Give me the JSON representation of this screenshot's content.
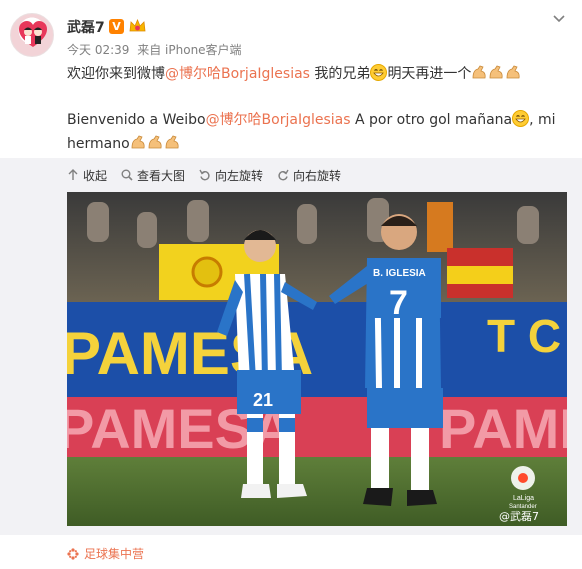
{
  "header": {
    "username": "武磊7",
    "time": "今天 02:39",
    "source": "来自 iPhone客户端"
  },
  "post": {
    "zh_before": "欢迎你来到微博",
    "zh_mention": "@博尔哈BorjaIglesias",
    "zh_after": " 我的兄弟",
    "zh_tail": "明天再进一个",
    "es_before": "Bienvenido a Weibo",
    "es_mention": "@博尔哈BorjaIglesias",
    "es_after": " A por otro gol mañana",
    "es_tail": ", mi",
    "es_line3": "hermano"
  },
  "toolbar": {
    "collapse": "收起",
    "view_large": "查看大图",
    "rotate_left": "向左旋转",
    "rotate_right": "向右旋转"
  },
  "photo": {
    "banner_text_1": "PAMESA",
    "banner_text_2": "PAMESA",
    "banner_text_3": "PAMESA",
    "jersey_left": "21",
    "jersey_right": "7",
    "jersey_name": "B. IGLESIA",
    "laliga_label": "LaLiga",
    "laliga_sub": "Santander",
    "watermark": "@武磊7"
  },
  "footer": {
    "topic": "足球集中营"
  },
  "colors": {
    "link": "#eb7350",
    "panel_bg": "#f2f2f5",
    "verified": "#ff8200"
  }
}
